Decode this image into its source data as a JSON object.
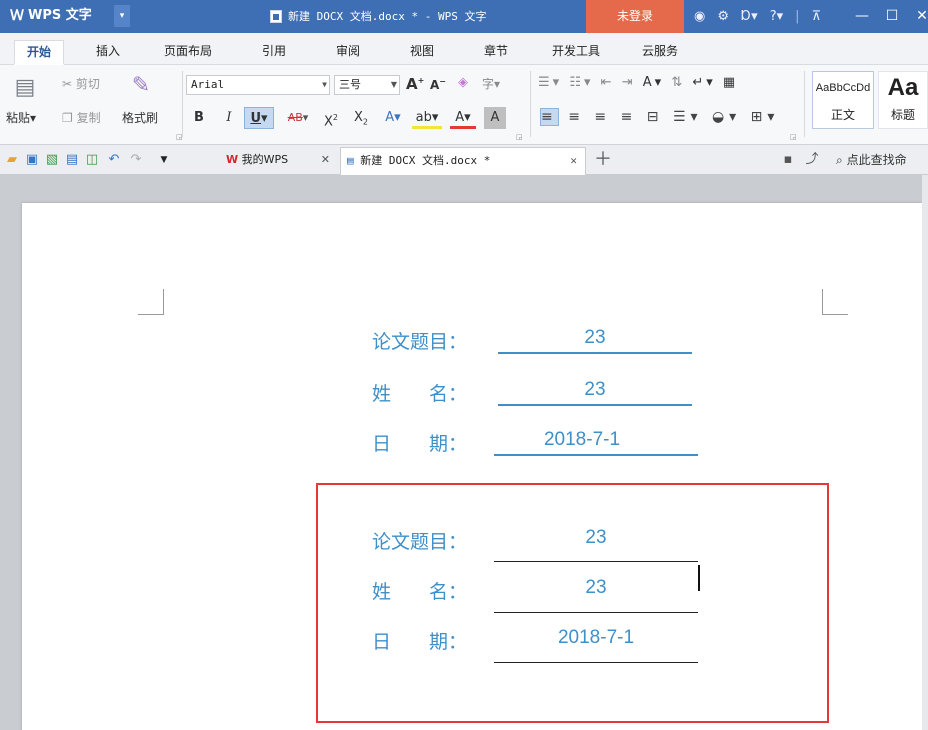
{
  "title_bar": {
    "app_name": "WPS 文字",
    "window_title": "新建 DOCX 文档.docx * - WPS 文字",
    "login_label": "未登录",
    "help_label": "?"
  },
  "ribbon_tabs": [
    "开始",
    "插入",
    "页面布局",
    "引用",
    "审阅",
    "视图",
    "章节",
    "开发工具",
    "云服务"
  ],
  "ribbon": {
    "paste_label": "粘贴",
    "cut_label": "剪切",
    "copy_label": "复制",
    "format_painter_label": "格式刷",
    "font_name": "Arial",
    "font_size": "三号",
    "bold": "B",
    "italic": "I",
    "underline": "U",
    "strike": "AB",
    "style_sample_1": "AaBbCcDd",
    "style_name_1": "正文",
    "style_sample_2": "Aa",
    "style_name_2": "标题"
  },
  "doc_tabs": [
    {
      "label": "我的WPS"
    },
    {
      "label": "新建 DOCX 文档.docx *"
    }
  ],
  "search_label": "点此查找命",
  "document": {
    "block1": {
      "title_label": "论文题目：",
      "title_value": "23",
      "name_label": "姓　　名：",
      "name_value": "23",
      "date_label": "日　　期：",
      "date_value": "2018-7-1"
    },
    "block2": {
      "title_label": "论文题目：",
      "title_value": "23",
      "name_label": "姓　　名：",
      "name_value": "23",
      "date_label": "日　　期：",
      "date_value": "2018-7-1"
    }
  },
  "colors": {
    "title_bar": "#3e6fb5",
    "login_button": "#e46a4b",
    "document_text": "#3f8fc9",
    "highlight_box": "#e53935"
  }
}
